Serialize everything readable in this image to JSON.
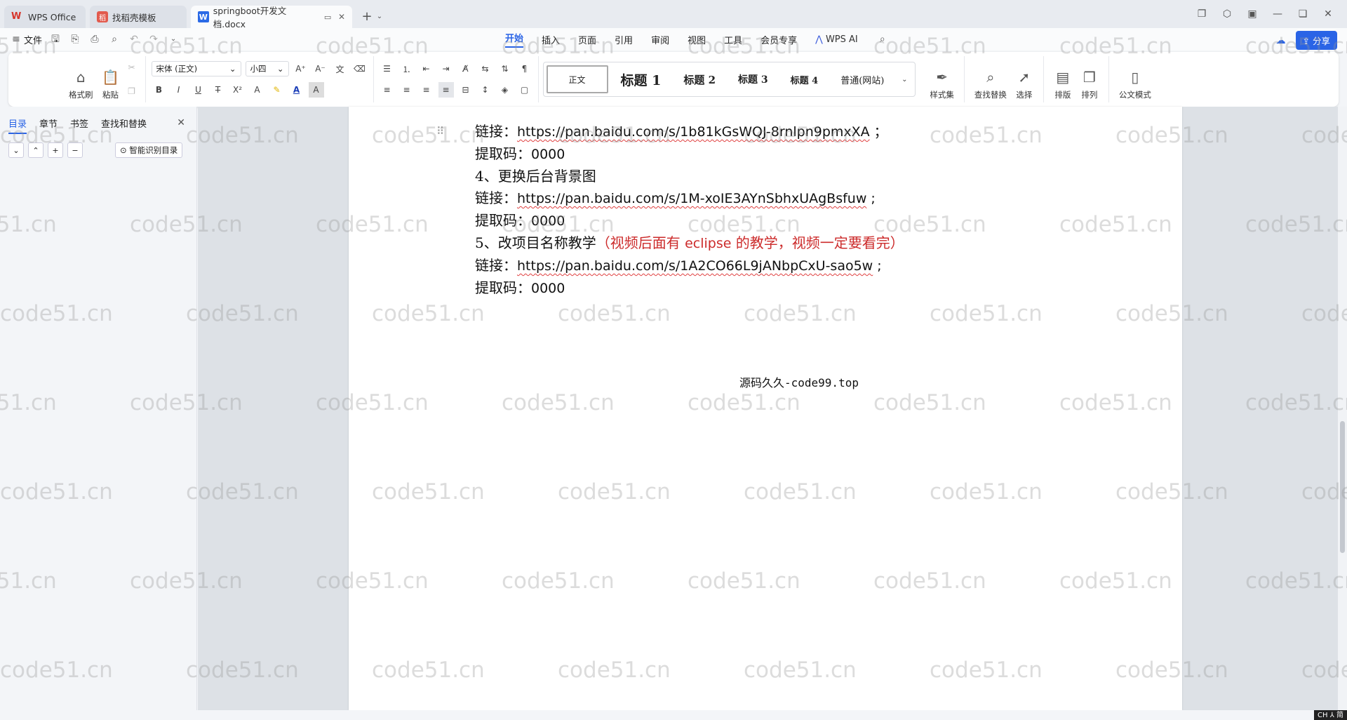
{
  "titlebar": {
    "tabs": [
      {
        "label": "WPS Office",
        "icon": "wps-logo-icon"
      },
      {
        "label": "找稻壳模板",
        "icon": "docer-icon"
      },
      {
        "label": "springboot开发文档.docx",
        "icon": "word-doc-icon"
      }
    ]
  },
  "menubar": {
    "file_label": "文件",
    "menus": [
      "开始",
      "插入",
      "页面",
      "引用",
      "审阅",
      "视图",
      "工具",
      "会员专享"
    ],
    "wps_ai": "WPS AI",
    "share": "分享"
  },
  "ribbon": {
    "format_painter": "格式刷",
    "paste": "粘贴",
    "font_name": "宋体 (正文)",
    "font_size": "小四",
    "styles": [
      "正文",
      "标题 1",
      "标题 2",
      "标题 3",
      "标题 4",
      "普通(网站)"
    ],
    "style_set": "样式集",
    "find_replace": "查找替换",
    "select": "选择",
    "layout": "排版",
    "arrange": "排列",
    "official_mode": "公文模式"
  },
  "leftpanel": {
    "tabs": [
      "目录",
      "章节",
      "书签",
      "查找和替换"
    ],
    "ai_toc": "智能识别目录"
  },
  "document": {
    "p1_prefix": "链接：",
    "p1_url": "https://pan.baidu.com/s/1b81kGsWQJ-8rnlpn9pmxXA",
    "p1_suffix": " ；",
    "p2_prefix": "提取码：",
    "p2_code": "0000",
    "p3": "4、更换后台背景图",
    "p4_prefix": "链接：",
    "p4_url": "https://pan.baidu.com/s/1M-xoIE3AYnSbhxUAgBsfuw",
    "p4_suffix": " ;",
    "p5_prefix": "提取码：",
    "p5_code": "0000",
    "p6_main": "5、改项目名称教学",
    "p6_red_a": "（视频后面有 ",
    "p6_red_b": "eclipse",
    "p6_red_c": " 的教学，视频一定要看完）",
    "p7_prefix": "链接：",
    "p7_url": "https://pan.baidu.com/s/1A2CO66L9jANbpCxU-sao5w",
    "p7_suffix": " ;",
    "p8_prefix": "提取码：",
    "p8_code": "0000",
    "footer": "源码久久-code99.top"
  },
  "watermark_text": "code51.cn",
  "colors": {
    "accent": "#2a64e6",
    "red_text": "#cc2b2b",
    "wps_red": "#d6352b"
  }
}
